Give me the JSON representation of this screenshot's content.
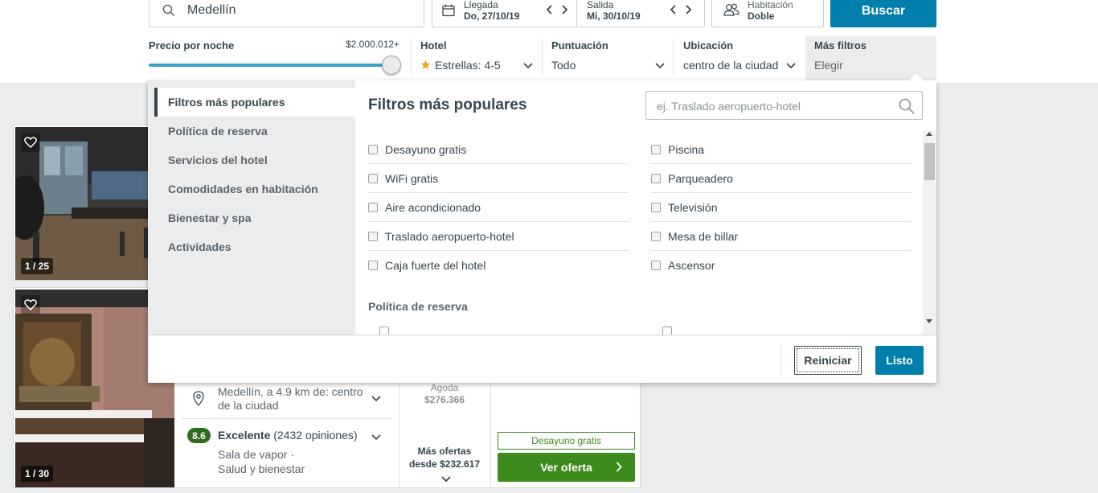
{
  "search": {
    "destination": "Medellín"
  },
  "dates": {
    "checkin_label": "Llegada",
    "checkin_value": "Do, 27/10/19",
    "checkout_label": "Salida",
    "checkout_value": "Mi, 30/10/19"
  },
  "room": {
    "label": "Habitación",
    "value": "Doble"
  },
  "search_button": "Buscar",
  "filters": {
    "price": {
      "title": "Precio por noche",
      "max": "$2.000.012+",
      "level_percent": 100
    },
    "hotel": {
      "title": "Hotel",
      "value": "Estrellas: 4-5"
    },
    "rating": {
      "title": "Puntuación",
      "value": "Todo"
    },
    "location": {
      "title": "Ubicación",
      "value": "centro de la ciudad"
    },
    "more": {
      "title": "Más filtros",
      "value": "Elegir"
    }
  },
  "panel": {
    "sidebar": [
      "Filtros más populares",
      "Política de reserva",
      "Servicios del hotel",
      "Comodidades en habitación",
      "Bienestar y spa",
      "Actividades"
    ],
    "title": "Filtros más populares",
    "search_placeholder": "ej. Traslado aeropuerto-hotel",
    "options_left": [
      "Desayuno gratis",
      "WiFi gratis",
      "Aire acondicionado",
      "Traslado aeropuerto-hotel",
      "Caja fuerte del hotel"
    ],
    "options_right": [
      "Piscina",
      "Parqueadero",
      "Televisión",
      "Mesa de billar",
      "Ascensor"
    ],
    "subheading": "Política de reserva",
    "reset": "Reiniciar",
    "done": "Listo"
  },
  "cards": [
    {
      "photo_counter": "1 / 25"
    },
    {
      "photo_counter": "1 / 30",
      "location": "Medellín, a 4.9 km de: centro de la ciudad",
      "rating_score": "8.6",
      "rating_label": "Excelente",
      "rating_count": "(2432 opiniones)",
      "amenities": [
        "Sala de vapor ·",
        "Salud y bienestar"
      ],
      "provider": "Agoda",
      "provider_price": "$276.366",
      "more_offers_line1": "Más ofertas",
      "more_offers_line2": "desde $232.617",
      "breakfast_tag": "Desayuno gratis",
      "cta": "Ver oferta"
    }
  ],
  "colors": {
    "primary": "#007fad",
    "green": "#3d8a1d",
    "rating": "#2f6b1f",
    "star": "#f0a31c"
  }
}
